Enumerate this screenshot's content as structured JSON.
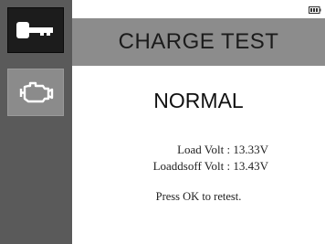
{
  "sidebar": {
    "items": [
      {
        "icon": "key-icon",
        "selected": true
      },
      {
        "icon": "engine-icon",
        "selected": false
      }
    ]
  },
  "header": {
    "title": "CHARGE TEST"
  },
  "status_bar": {
    "battery_icon": "battery-icon"
  },
  "result": {
    "status": "NORMAL",
    "load_volt": "Load Volt : 13.33V",
    "loadoff_volt": "Loaddsoff Volt : 13.43V",
    "prompt": "Press OK to retest."
  },
  "colors": {
    "sidebar": "#5a5a5a",
    "selected_tab": "#1c1c1c",
    "unselected_tab": "#8b8b8b",
    "header": "#8c8c8c",
    "background": "#ffffff"
  }
}
